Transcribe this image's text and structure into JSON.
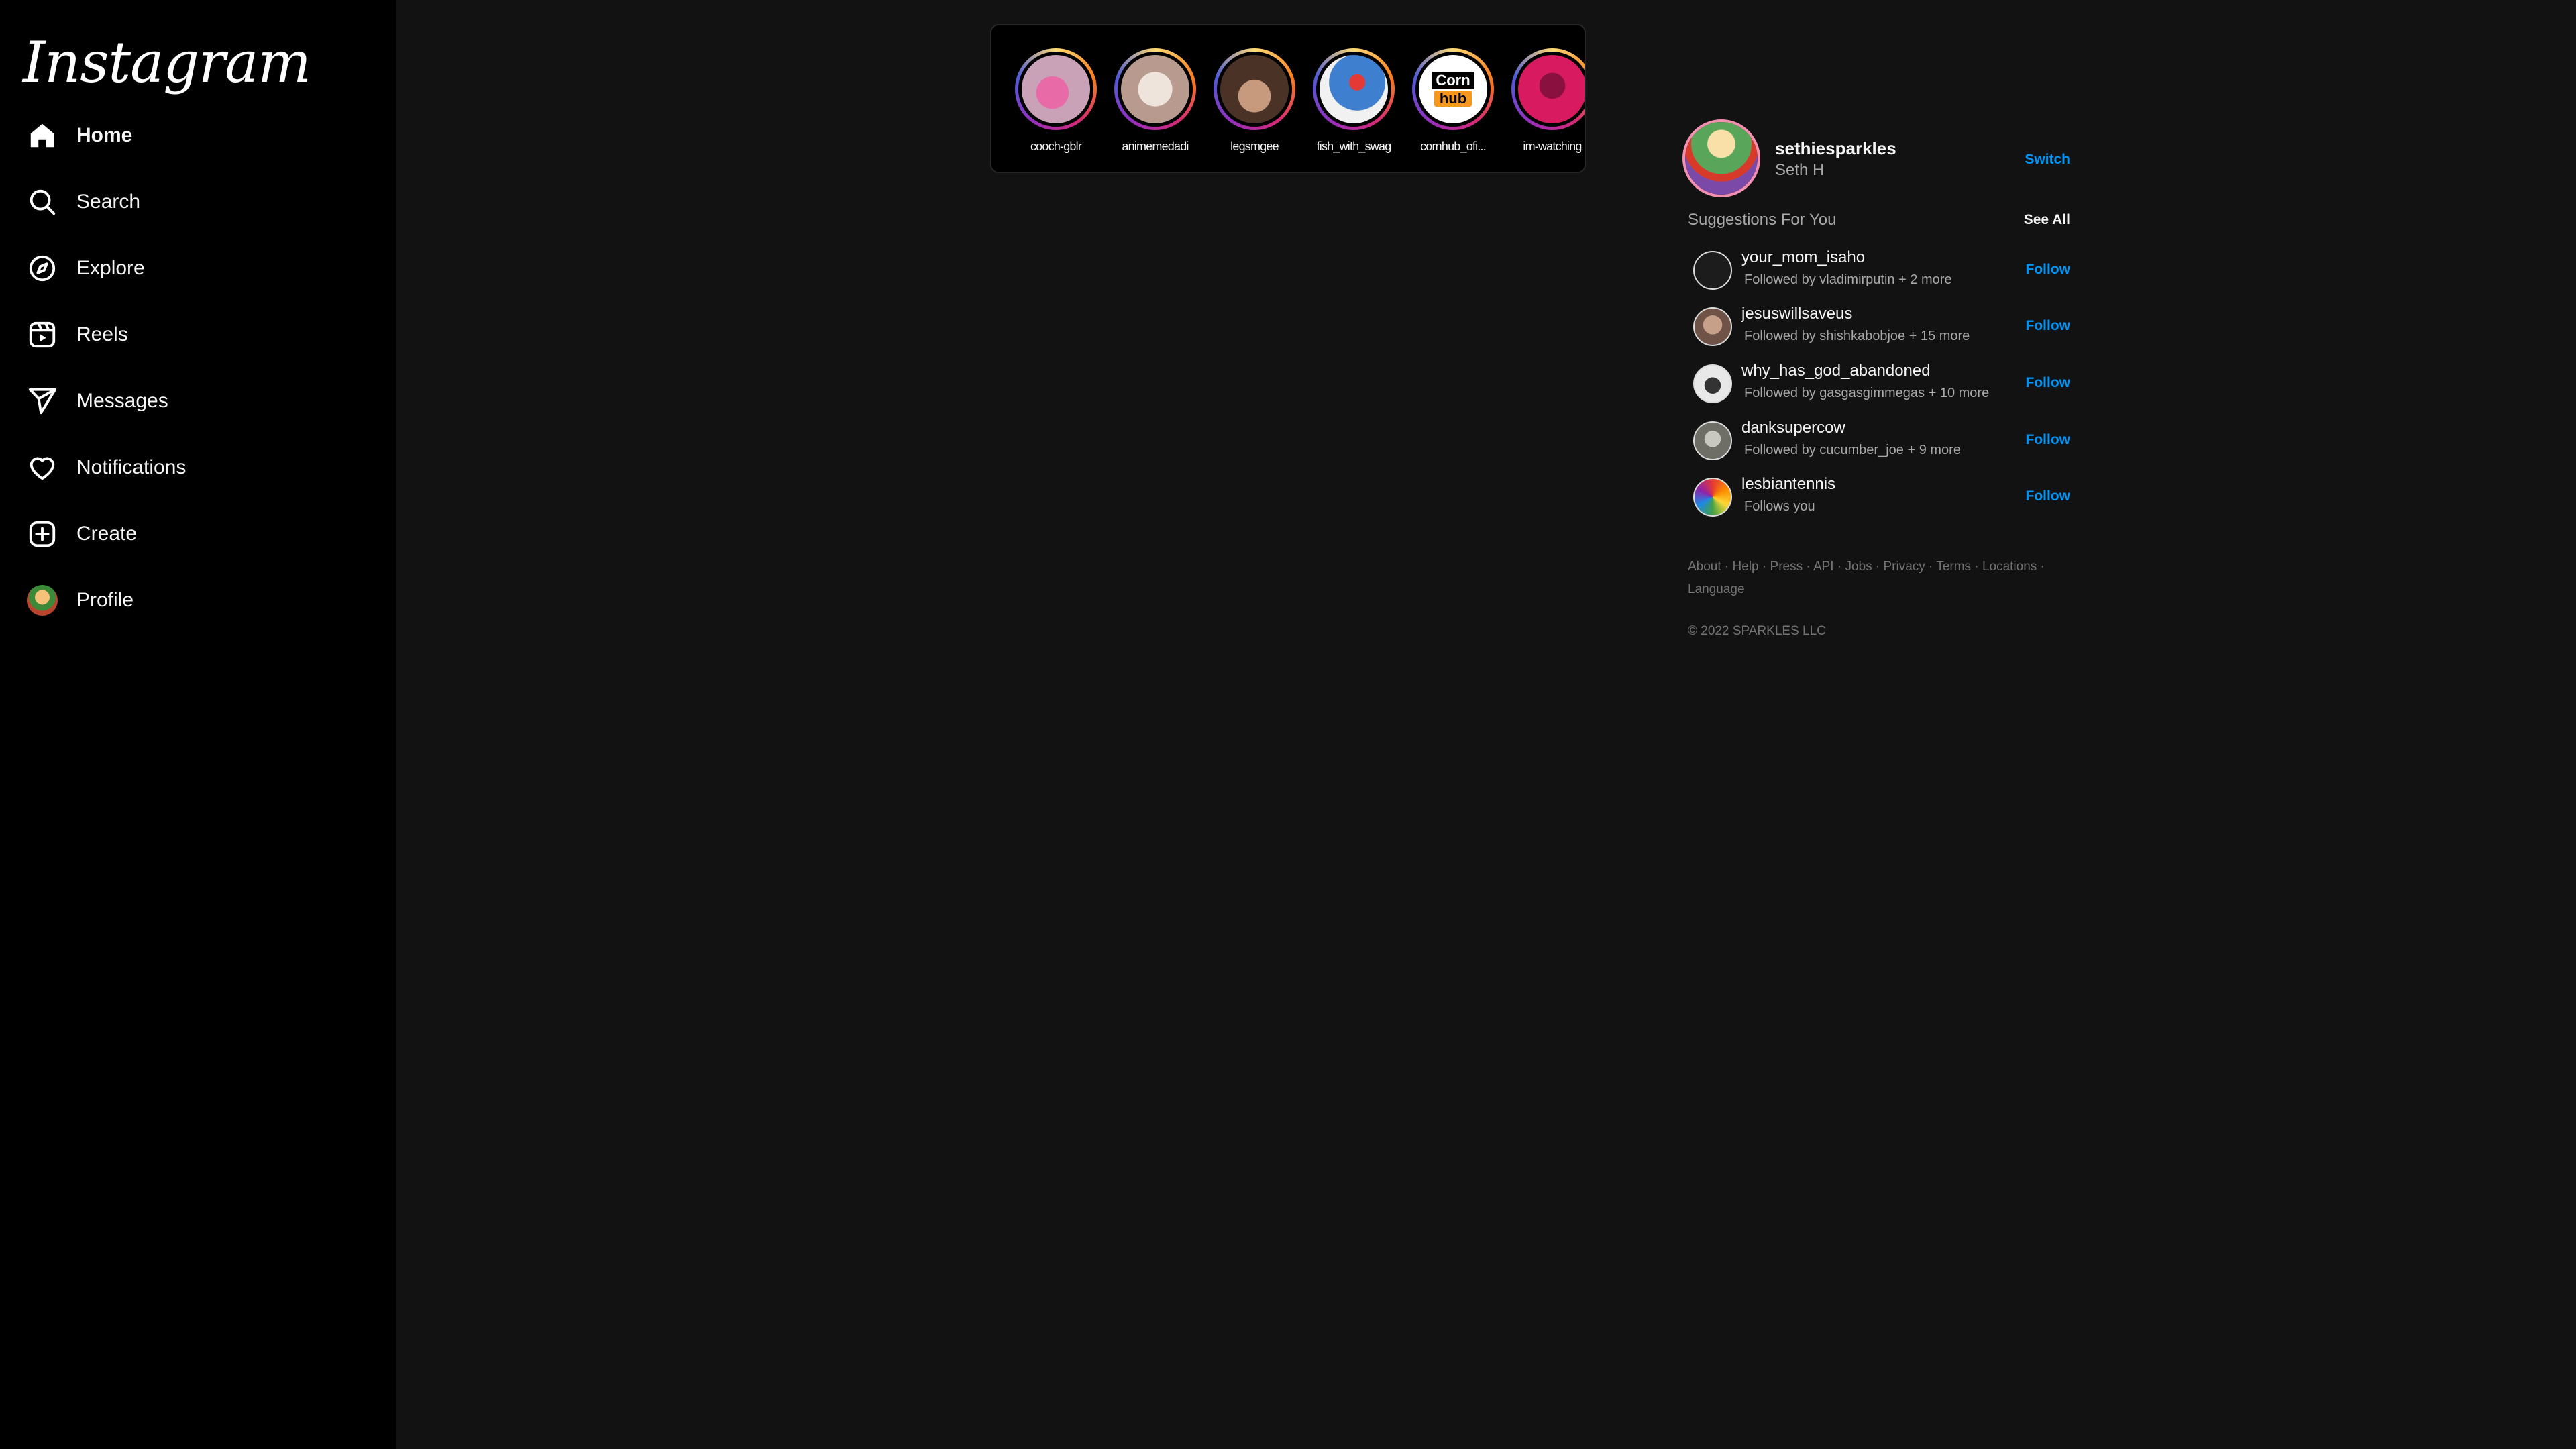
{
  "app": {
    "logo": "Instagram"
  },
  "nav": [
    {
      "label": "Home",
      "icon": "home-icon",
      "active": true
    },
    {
      "label": "Search",
      "icon": "search-icon"
    },
    {
      "label": "Explore",
      "icon": "compass-icon"
    },
    {
      "label": "Reels",
      "icon": "reels-icon"
    },
    {
      "label": "Messages",
      "icon": "send-icon"
    },
    {
      "label": "Notifications",
      "icon": "heart-icon"
    },
    {
      "label": "Create",
      "icon": "plus-square-icon"
    },
    {
      "label": "Profile",
      "icon": "profile-avatar"
    }
  ],
  "stories": [
    {
      "username": "cooch-gblr",
      "color": "#c9a2b8"
    },
    {
      "username": "animemedadi",
      "color": "#d7c6c0"
    },
    {
      "username": "legsmgee",
      "color": "#6b4a3a"
    },
    {
      "username": "fish_with_swag",
      "color": "#3f7fd0"
    },
    {
      "username": "cornhub_ofi...",
      "color": "#ffffff"
    },
    {
      "username": "im-watching",
      "color": "#d81b60"
    }
  ],
  "me": {
    "username": "sethiesparkles",
    "name": "Seth H",
    "switch_label": "Switch"
  },
  "suggestions": {
    "title": "Suggestions For You",
    "see_all": "See All",
    "follow_label": "Follow",
    "items": [
      {
        "username": "your_mom_isaho",
        "sub": "Followed by vladimirputin  + 2 more",
        "color": "#1c1c1c"
      },
      {
        "username": "jesuswillsaveus",
        "sub": "Followed by shishkabobjoe  + 15 more",
        "color": "#9b7b6a"
      },
      {
        "username": "why_has_god_abandoned",
        "sub": "Followed by gasgasgimmegas  + 10 more",
        "color": "#e8e8e8"
      },
      {
        "username": "danksupercow",
        "sub": "Followed by cucumber_joe  + 9 more",
        "color": "#8a8a80"
      },
      {
        "username": "lesbiantennis",
        "sub": "Follows you",
        "color": "#e53935"
      }
    ]
  },
  "footer": {
    "links": [
      "About",
      "Help",
      "Press",
      "API",
      "Jobs",
      "Privacy",
      "Terms",
      "Locations",
      "Language"
    ],
    "copyright": "© 2022  SPARKLES LLC"
  }
}
